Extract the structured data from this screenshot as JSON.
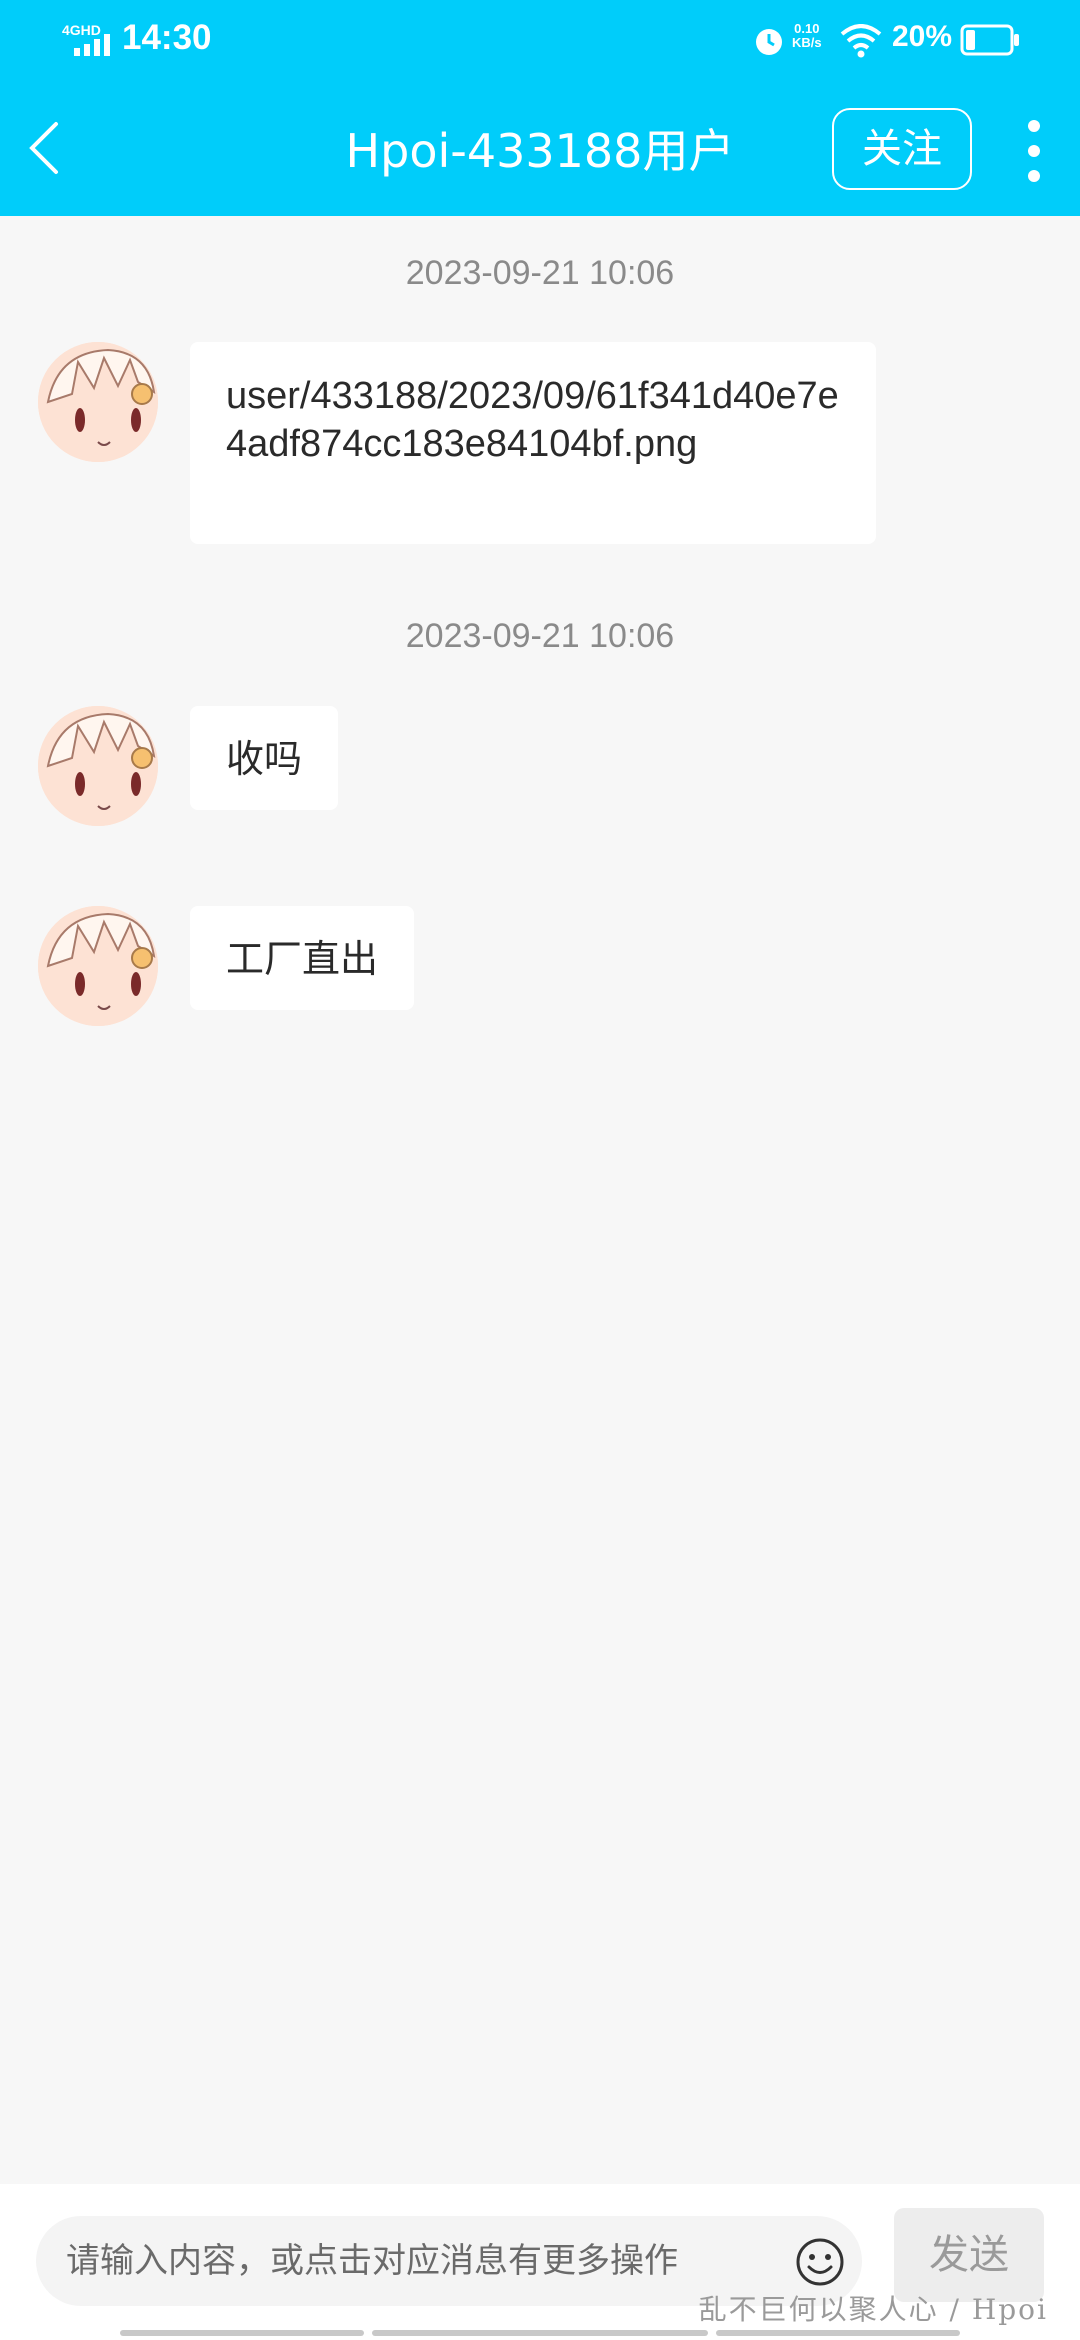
{
  "status_bar": {
    "network": "4GHD",
    "time": "14:30",
    "speed_value": "0.10",
    "speed_unit": "KB/s",
    "battery": "20%"
  },
  "header": {
    "title": "Hpoi-433188用户",
    "follow_label": "关注"
  },
  "messages": [
    {
      "timestamp": "2023-09-21 10:06",
      "text": "user/433188/2023/09/61f341d40e7e4adf874cc183e84104bf.png"
    },
    {
      "timestamp": "2023-09-21 10:06",
      "text": "收吗"
    },
    {
      "timestamp": "",
      "text": "工厂直出"
    }
  ],
  "input": {
    "placeholder": "请输入内容，或点击对应消息有更多操作",
    "send_label": "发送"
  },
  "watermark": "乱不巨何以聚人心 / Hpoi",
  "colors": {
    "header": "#00cdfa",
    "background": "#f7f7f7",
    "bubble": "#ffffff"
  },
  "icons": [
    "back-icon",
    "more-icon",
    "emoji-icon",
    "alarm-icon",
    "wifi-icon",
    "battery-icon",
    "signal-icon"
  ]
}
